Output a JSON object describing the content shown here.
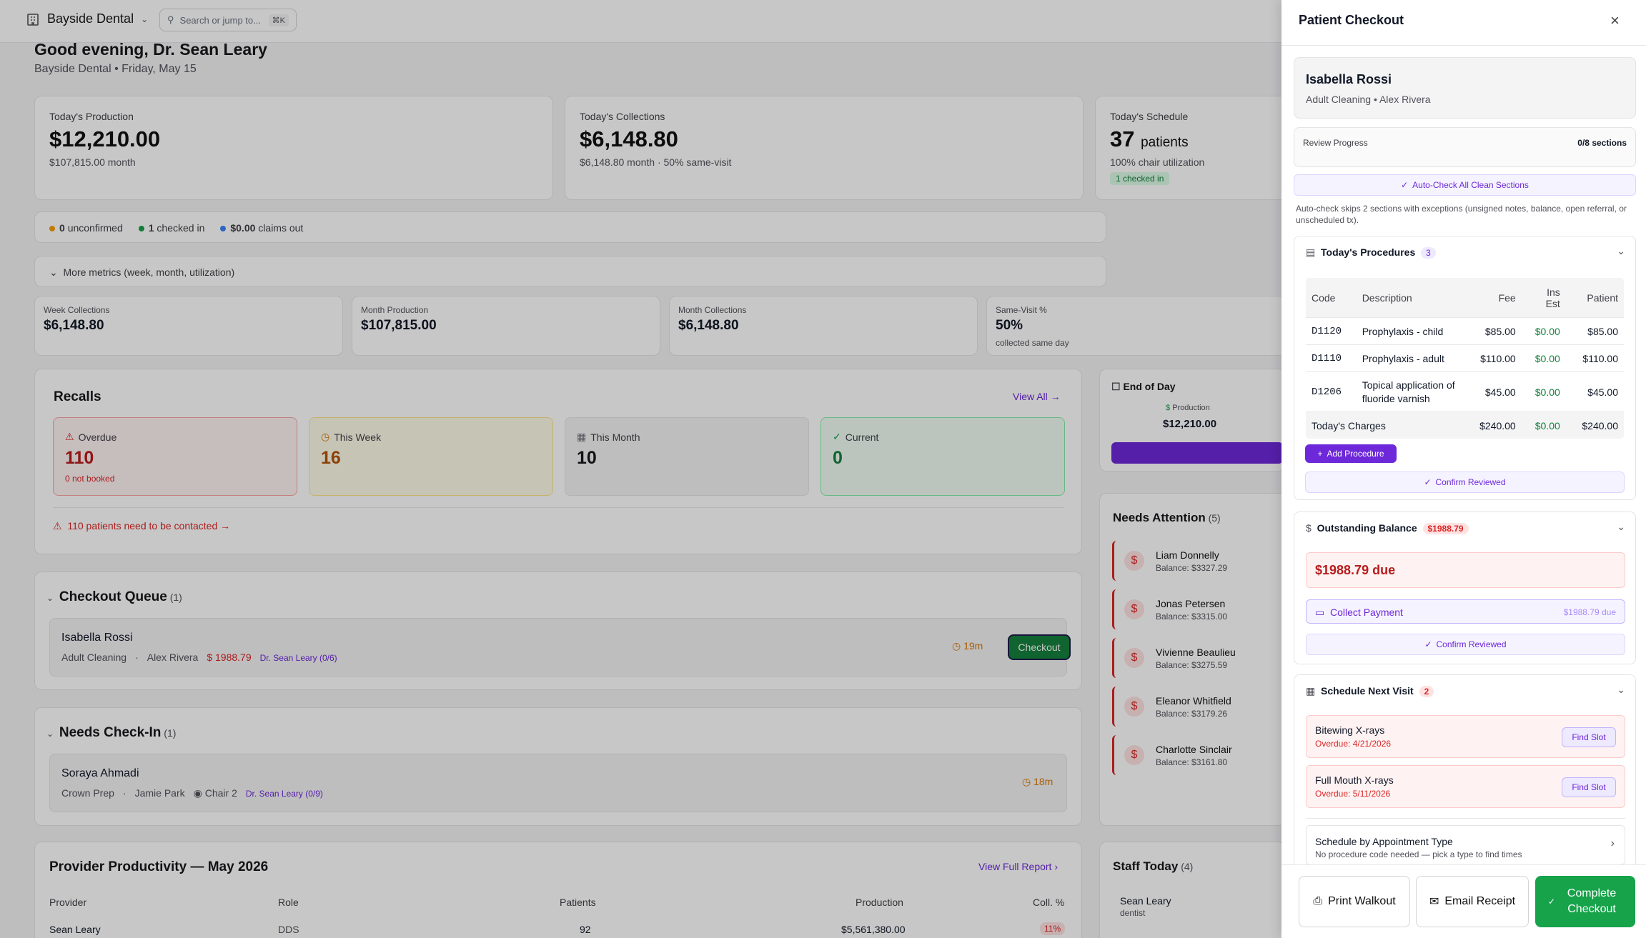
{
  "topbar": {
    "practice": "Bayside Dental",
    "search_placeholder": "Search or jump to...",
    "shortcut": "⌘K"
  },
  "greeting": {
    "title": "Good evening, Dr. Sean Leary",
    "subtitle": "Bayside Dental • Friday, May 15"
  },
  "kpis": [
    {
      "title": "Today's Production",
      "value": "$12,210.00",
      "sub": "$107,815.00 month"
    },
    {
      "title": "Today's Collections",
      "value": "$6,148.80",
      "sub": "$6,148.80 month · 50% same-visit"
    },
    {
      "title": "Today's Schedule",
      "value": "37",
      "unit": "patients",
      "sub": "100% chair utilization",
      "badge": "1 checked in"
    }
  ],
  "status": {
    "unconfirmed_count": "0",
    "unconfirmed_label": "unconfirmed",
    "checked_count": "1",
    "checked_label": "checked in",
    "claims_count": "$0.00",
    "claims_label": "claims out"
  },
  "more_metrics": "More metrics (week, month, utilization)",
  "metrics": [
    {
      "title": "Week Collections",
      "value": "$6,148.80"
    },
    {
      "title": "Month Production",
      "value": "$107,815.00"
    },
    {
      "title": "Month Collections",
      "value": "$6,148.80"
    },
    {
      "title": "Same-Visit %",
      "value": "50%",
      "sub": "collected same day"
    }
  ],
  "recalls": {
    "title": "Recalls",
    "view_all": "View All",
    "overdue": {
      "label": "Overdue",
      "value": "110",
      "sub": "0 not booked"
    },
    "week": {
      "label": "This Week",
      "value": "16"
    },
    "month": {
      "label": "This Month",
      "value": "10"
    },
    "current": {
      "label": "Current",
      "value": "0"
    },
    "alert": "110 patients need to be contacted"
  },
  "eod": {
    "title": "End of Day",
    "prod_label": "Production",
    "prod_value": "$12,210.00"
  },
  "checkout_queue": {
    "title": "Checkout Queue",
    "count": "(1)",
    "patient": "Isabella Rossi",
    "procedure": "Adult Cleaning",
    "sep": "·",
    "hygienist": "Alex Rivera",
    "balance": "$ 1988.79",
    "provider": "Dr. Sean Leary (0/6)",
    "wait": "19m",
    "button": "Checkout"
  },
  "needs_checkin": {
    "title": "Needs Check-In",
    "count": "(1)",
    "patient": "Soraya Ahmadi",
    "procedure": "Crown Prep",
    "sep": "·",
    "provider_staff": "Jamie Park",
    "chair": "Chair 2",
    "provider": "Dr. Sean Leary (0/9)",
    "wait": "18m"
  },
  "needs_attention": {
    "title": "Needs Attention",
    "count": "(5)",
    "items": [
      {
        "name": "Liam Donnelly",
        "balance": "Balance: $3327.29"
      },
      {
        "name": "Jonas Petersen",
        "balance": "Balance: $3315.00"
      },
      {
        "name": "Vivienne Beaulieu",
        "balance": "Balance: $3275.59"
      },
      {
        "name": "Eleanor Whitfield",
        "balance": "Balance: $3179.26"
      },
      {
        "name": "Charlotte Sinclair",
        "balance": "Balance: $3161.80"
      }
    ]
  },
  "productivity": {
    "title": "Provider Productivity — May 2026",
    "link": "View Full Report",
    "headers": [
      "Provider",
      "Role",
      "Patients",
      "Production",
      "Coll. %"
    ],
    "rows": [
      {
        "provider": "Sean Leary",
        "role": "DDS",
        "patients": "92",
        "production": "$5,561,380.00",
        "coll": "11%"
      }
    ]
  },
  "staff": {
    "title": "Staff Today",
    "count": "(4)",
    "name": "Sean Leary",
    "role": "dentist"
  },
  "checkout": {
    "title": "Patient Checkout",
    "patient": "Isabella Rossi",
    "patient_sub": "Adult Cleaning • Alex Rivera",
    "review_label": "Review Progress",
    "review_value": "0/8 sections",
    "autocheck": "Auto-Check All Clean Sections",
    "autocheck_note": "Auto-check skips 2 sections with exceptions (unsigned notes, balance, open referral, or unscheduled tx).",
    "procedures": {
      "title": "Today's Procedures",
      "count": "3",
      "headers": {
        "code": "Code",
        "desc": "Description",
        "fee": "Fee",
        "ins1": "Ins",
        "ins2": "Est",
        "patient": "Patient"
      },
      "rows": [
        {
          "code": "D1120",
          "desc": "Prophylaxis - child",
          "fee": "$85.00",
          "ins": "$0.00",
          "pat": "$85.00"
        },
        {
          "code": "D1110",
          "desc": "Prophylaxis - adult",
          "fee": "$110.00",
          "ins": "$0.00",
          "pat": "$110.00"
        },
        {
          "code": "D1206",
          "desc": "Topical application of fluoride varnish",
          "fee": "$45.00",
          "ins": "$0.00",
          "pat": "$45.00"
        }
      ],
      "total_label": "Today's Charges",
      "total_fee": "$240.00",
      "total_ins": "$0.00",
      "total_pat": "$240.00",
      "add": "Add Procedure",
      "confirm": "Confirm Reviewed"
    },
    "balance": {
      "title": "Outstanding Balance",
      "badge": "$1988.79",
      "due": "$1988.79 due",
      "collect": "Collect Payment",
      "collect_due": "$1988.79 due",
      "confirm": "Confirm Reviewed"
    },
    "schedule": {
      "title": "Schedule Next Visit",
      "count": "2",
      "items": [
        {
          "name": "Bitewing X-rays",
          "overdue": "Overdue: 4/21/2026",
          "button": "Find Slot"
        },
        {
          "name": "Full Mouth X-rays",
          "overdue": "Overdue: 5/11/2026",
          "button": "Find Slot"
        }
      ],
      "by_type": "Schedule by Appointment Type",
      "by_type_sub": "No procedure code needed — pick a type to find times"
    },
    "footer": {
      "print": "Print Walkout",
      "email": "Email Receipt",
      "complete": "Complete Checkout"
    }
  }
}
